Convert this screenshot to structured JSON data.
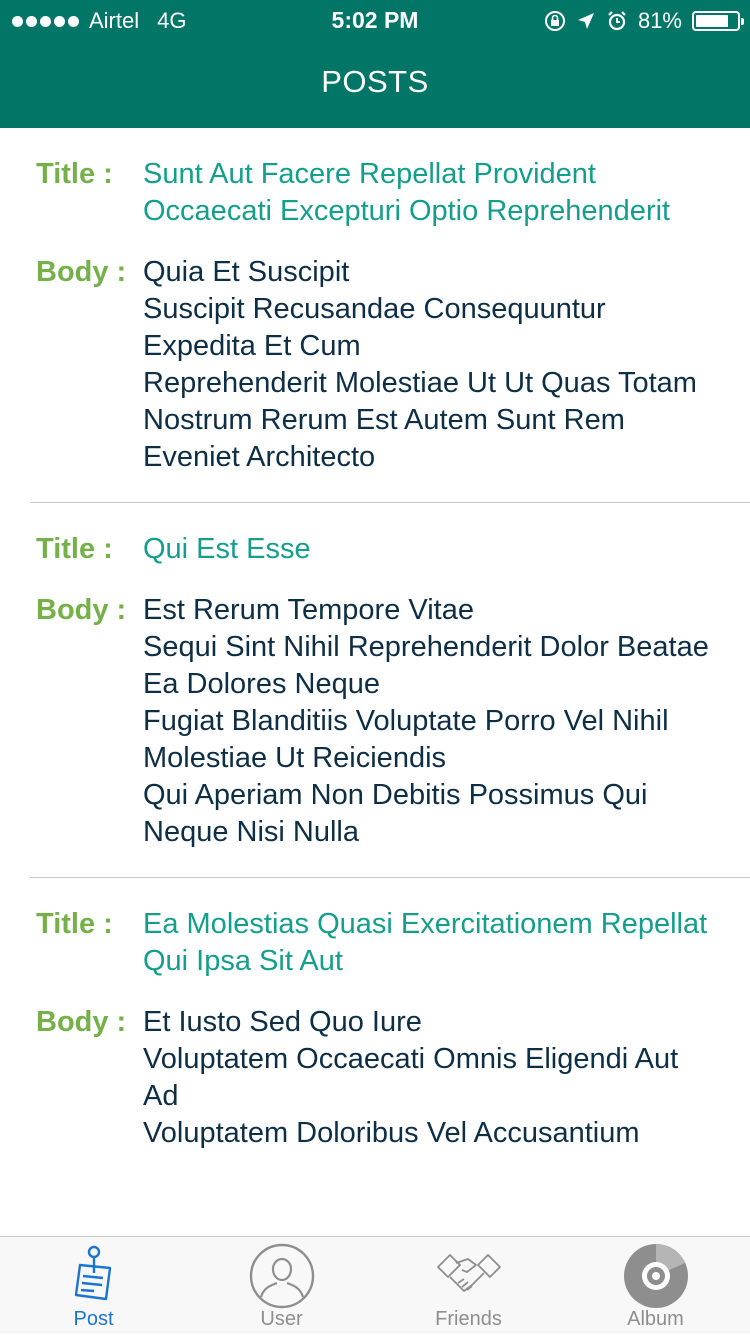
{
  "status_bar": {
    "carrier": "Airtel",
    "network": "4G",
    "time": "5:02 PM",
    "battery": "81%",
    "battery_level": 0.81
  },
  "nav": {
    "title": "POSTS"
  },
  "posts": [
    {
      "title_label": "Title :",
      "title": "Sunt Aut Facere Repellat Provident Occaecati Excepturi Optio Reprehenderit",
      "body_label": "Body :",
      "body": "Quia Et Suscipit\nSuscipit Recusandae Consequuntur Expedita Et Cum\nReprehenderit Molestiae Ut Ut Quas Totam\nNostrum Rerum Est Autem Sunt Rem Eveniet Architecto"
    },
    {
      "title_label": "Title :",
      "title": "Qui Est Esse",
      "body_label": "Body :",
      "body": "Est Rerum Tempore Vitae\nSequi Sint Nihil Reprehenderit Dolor Beatae Ea Dolores Neque\nFugiat Blanditiis Voluptate Porro Vel Nihil Molestiae Ut Reiciendis\nQui Aperiam Non Debitis Possimus Qui Neque Nisi Nulla"
    },
    {
      "title_label": "Title :",
      "title": "Ea Molestias Quasi Exercitationem Repellat Qui Ipsa Sit Aut",
      "body_label": "Body :",
      "body": "Et Iusto Sed Quo Iure\nVoluptatem Occaecati Omnis Eligendi Aut Ad\nVoluptatem Doloribus Vel Accusantium"
    }
  ],
  "tabs": [
    {
      "label": "Post",
      "icon": "post-icon",
      "active": true
    },
    {
      "label": "User",
      "icon": "user-icon",
      "active": false
    },
    {
      "label": "Friends",
      "icon": "handshake-icon",
      "active": false
    },
    {
      "label": "Album",
      "icon": "album-icon",
      "active": false
    }
  ],
  "colors": {
    "header": "#027666",
    "label_green": "#76b04a",
    "title_teal": "#149e8b",
    "body_text": "#0e2e45",
    "tab_active": "#1b74d0",
    "tab_inactive": "#8e8e8e"
  }
}
